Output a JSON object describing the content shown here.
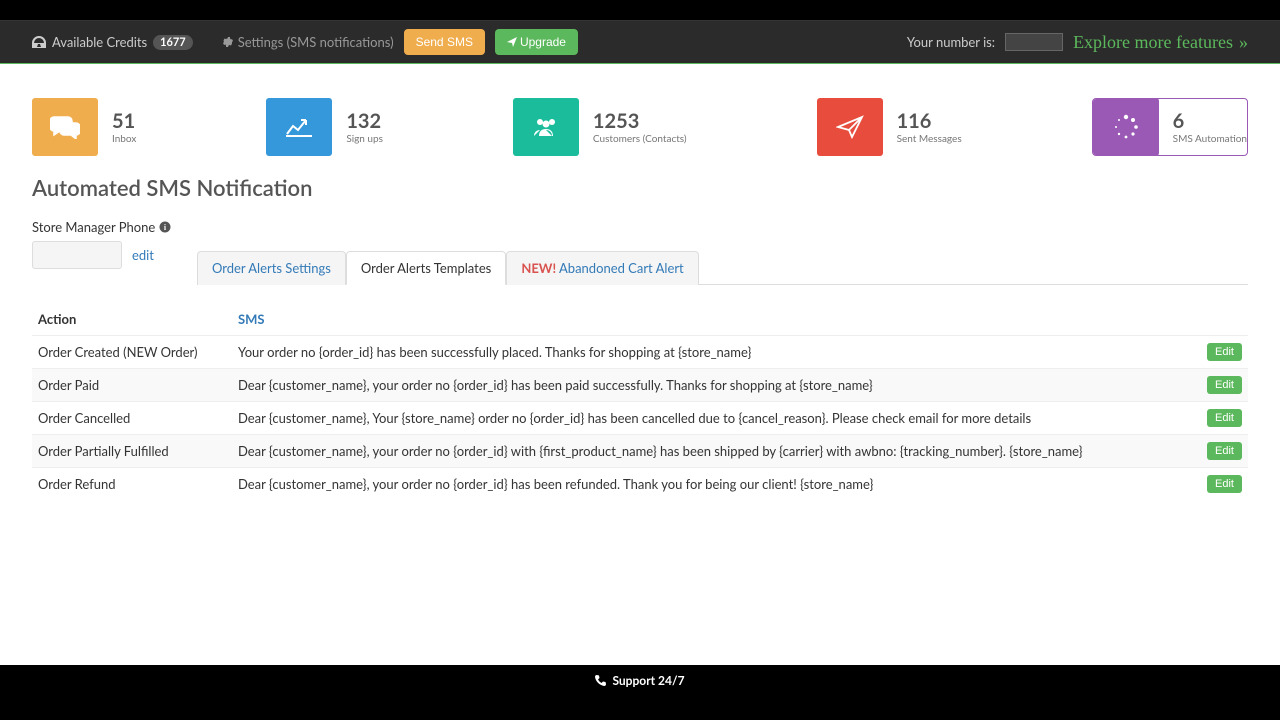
{
  "header": {
    "credits_label": "Available Credits",
    "credits_count": "1677",
    "settings_label": "Settings (SMS notifications)",
    "send_sms": "Send SMS",
    "upgrade": "Upgrade",
    "your_number_label": "Your number is:",
    "explore": "Explore more features"
  },
  "stats": [
    {
      "num": "51",
      "label": "Inbox"
    },
    {
      "num": "132",
      "label": "Sign ups"
    },
    {
      "num": "1253",
      "label": "Customers (Contacts)"
    },
    {
      "num": "116",
      "label": "Sent Messages"
    },
    {
      "num": "6",
      "label": "SMS Automation"
    }
  ],
  "page_title": "Automated SMS Notification",
  "phone_label": "Store Manager Phone",
  "edit_link": "edit",
  "tabs": {
    "settings": "Order Alerts Settings",
    "templates": "Order Alerts Templates",
    "new_badge": "NEW!",
    "abandoned": "Abandoned Cart Alert"
  },
  "table": {
    "header_action": "Action",
    "header_sms": "SMS",
    "edit_btn": "Edit",
    "rows": [
      {
        "action": "Order Created (NEW Order)",
        "sms": "Your order no {order_id} has been successfully placed. Thanks for shopping at {store_name}"
      },
      {
        "action": "Order Paid",
        "sms": "Dear {customer_name}, your order no {order_id} has been paid successfully. Thanks for shopping at {store_name}"
      },
      {
        "action": "Order Cancelled",
        "sms": "Dear {customer_name}, Your {store_name} order no {order_id} has been cancelled due to {cancel_reason}. Please check email for more details"
      },
      {
        "action": "Order Partially Fulfilled",
        "sms": "Dear {customer_name}, your order no {order_id} with {first_product_name} has been shipped by {carrier} with awbno: {tracking_number}. {store_name}"
      },
      {
        "action": "Order Refund",
        "sms": "Dear {customer_name}, your order no {order_id} has been refunded. Thank you for being our client! {store_name}"
      }
    ]
  },
  "footer": "Support 24/7"
}
